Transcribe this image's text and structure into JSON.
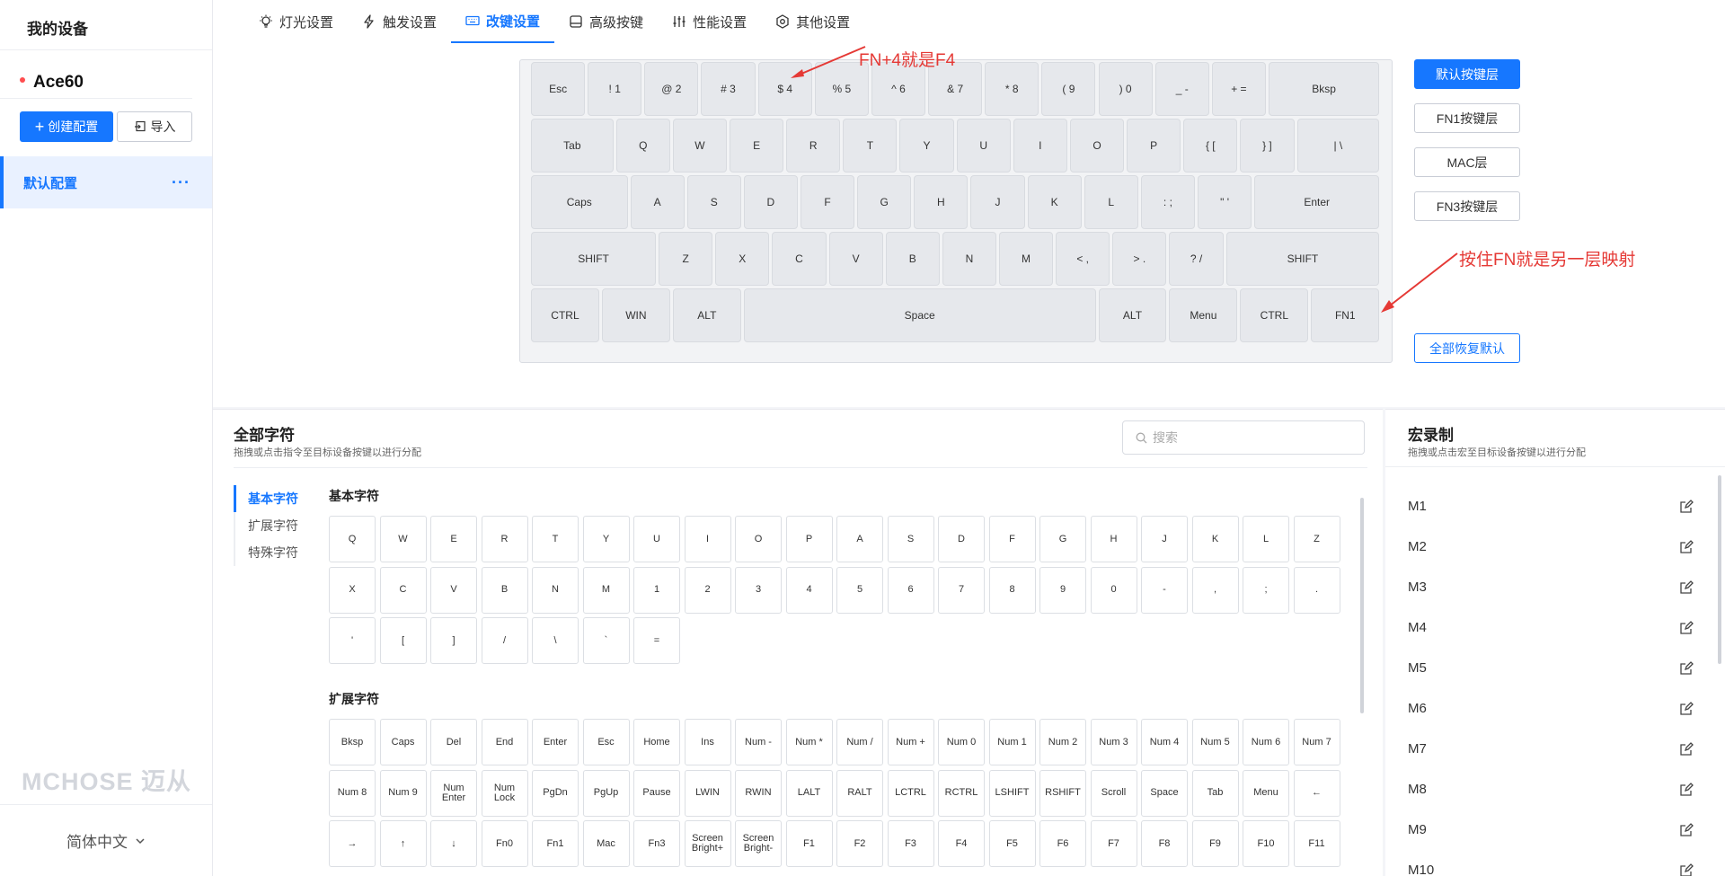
{
  "sidebar": {
    "title": "我的设备",
    "device": "Ace60",
    "create_label": "创建配置",
    "import_label": "导入",
    "config_item": "默认配置",
    "more": "···",
    "logo": "MCHOSE 迈从",
    "language": "简体中文"
  },
  "tabs": [
    {
      "label": "灯光设置",
      "icon": "lightbulb-icon"
    },
    {
      "label": "触发设置",
      "icon": "lightning-icon"
    },
    {
      "label": "改键设置",
      "icon": "keyboard-icon"
    },
    {
      "label": "高级按键",
      "icon": "advanced-key-icon"
    },
    {
      "label": "性能设置",
      "icon": "sliders-icon"
    },
    {
      "label": "其他设置",
      "icon": "settings-icon"
    }
  ],
  "keyboard": {
    "rows": [
      [
        "Esc",
        "! 1",
        "@ 2",
        "# 3",
        "$ 4",
        "% 5",
        "^ 6",
        "& 7",
        "* 8",
        "( 9",
        ") 0",
        "_ -",
        "+ =",
        "Bksp"
      ],
      [
        "Tab",
        "Q",
        "W",
        "E",
        "R",
        "T",
        "Y",
        "U",
        "I",
        "O",
        "P",
        "{ [",
        "} ]",
        "| \\"
      ],
      [
        "Caps",
        "A",
        "S",
        "D",
        "F",
        "G",
        "H",
        "J",
        "K",
        "L",
        ": ;",
        "\" '",
        "Enter"
      ],
      [
        "SHIFT",
        "Z",
        "X",
        "C",
        "V",
        "B",
        "N",
        "M",
        "< ,",
        "> .",
        "? /",
        "SHIFT"
      ],
      [
        "CTRL",
        "WIN",
        "ALT",
        "Space",
        "ALT",
        "Menu",
        "CTRL",
        "FN1"
      ]
    ]
  },
  "layers": {
    "buttons": [
      "默认按键层",
      "FN1按键层",
      "MAC层",
      "FN3按键层"
    ],
    "reset": "全部恢复默认"
  },
  "annotations": {
    "fn4": "FN+4就是F4",
    "fn_layer": "按住FN就是另一层映射",
    "color": "#e53935"
  },
  "chars": {
    "title": "全部字符",
    "subtitle": "拖拽或点击指令至目标设备按键以进行分配",
    "search_placeholder": "搜索",
    "nav": [
      "基本字符",
      "扩展字符",
      "特殊字符"
    ],
    "basic_title": "基本字符",
    "basic": [
      "Q",
      "W",
      "E",
      "R",
      "T",
      "Y",
      "U",
      "I",
      "O",
      "P",
      "A",
      "S",
      "D",
      "F",
      "G",
      "H",
      "J",
      "K",
      "L",
      "Z",
      "X",
      "C",
      "V",
      "B",
      "N",
      "M",
      "1",
      "2",
      "3",
      "4",
      "5",
      "6",
      "7",
      "8",
      "9",
      "0",
      "-",
      ",",
      ";",
      ".",
      "'",
      "[",
      "]",
      "/",
      "\\",
      "`",
      "="
    ],
    "ext_title": "扩展字符",
    "ext": [
      "Bksp",
      "Caps",
      "Del",
      "End",
      "Enter",
      "Esc",
      "Home",
      "Ins",
      "Num -",
      "Num *",
      "Num /",
      "Num +",
      "Num 0",
      "Num 1",
      "Num 2",
      "Num 3",
      "Num 4",
      "Num 5",
      "Num 6",
      "Num 7",
      "Num 8",
      "Num 9",
      "Num Enter",
      "Num Lock",
      "PgDn",
      "PgUp",
      "Pause",
      "LWIN",
      "RWIN",
      "LALT",
      "RALT",
      "LCTRL",
      "RCTRL",
      "LSHIFT",
      "RSHIFT",
      "Scroll",
      "Space",
      "Tab",
      "Menu",
      "←",
      "→",
      "↑",
      "↓",
      "Fn0",
      "Fn1",
      "Mac",
      "Fn3",
      "Screen Bright+",
      "Screen Bright-",
      "F1",
      "F2",
      "F3",
      "F4",
      "F5",
      "F6",
      "F7",
      "F8",
      "F9",
      "F10",
      "F11"
    ]
  },
  "macro": {
    "title": "宏录制",
    "subtitle": "拖拽或点击宏至目标设备按键以进行分配",
    "items": [
      "M1",
      "M2",
      "M3",
      "M4",
      "M5",
      "M6",
      "M7",
      "M8",
      "M9",
      "M10"
    ]
  },
  "colors": {
    "accent": "#1677ff",
    "alert": "#e53935"
  }
}
